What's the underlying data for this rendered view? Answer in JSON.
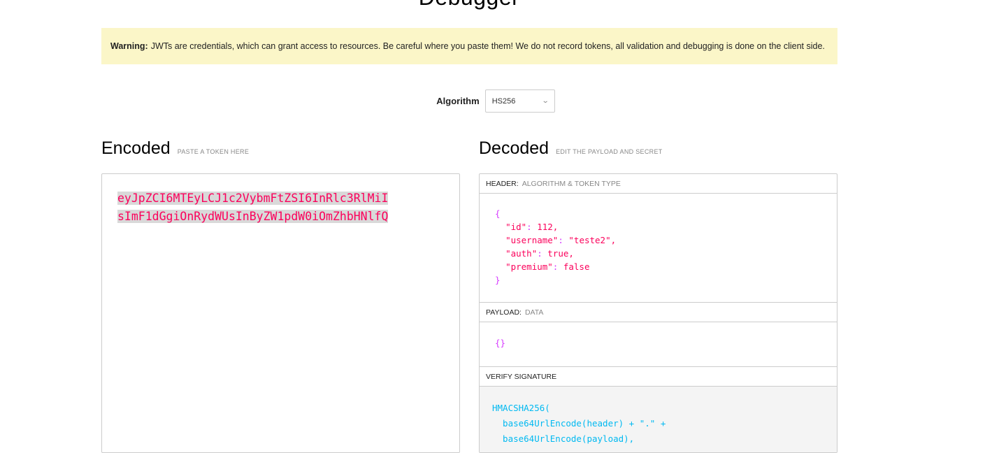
{
  "page": {
    "title": "Debugger"
  },
  "warning": {
    "label": "Warning:",
    "text": "JWTs are credentials, which can grant access to resources. Be careful where you paste them! We do not record tokens, all validation and debugging is done on the client side."
  },
  "algorithm": {
    "label": "Algorithm",
    "selected": "HS256"
  },
  "encoded": {
    "title": "Encoded",
    "hint": "PASTE A TOKEN HERE",
    "token_line1": "eyJpZCI6MTEyLCJ1c2VybmFtZSI6InRlc3RlMiI",
    "token_line2": "sImF1dGgiOnRydWUsInByZW1pdW0iOmZhbHNlfQ"
  },
  "decoded": {
    "title": "Decoded",
    "hint": "EDIT THE PAYLOAD AND SECRET",
    "header_section": {
      "label": "HEADER:",
      "sub": "ALGORITHM & TOKEN TYPE"
    },
    "header_json": {
      "open": "{",
      "lines": [
        {
          "key": "\"id\"",
          "value": "112,"
        },
        {
          "key": "\"username\"",
          "value": "\"teste2\","
        },
        {
          "key": "\"auth\"",
          "value": "true,"
        },
        {
          "key": "\"premium\"",
          "value": "false"
        }
      ],
      "close": "}"
    },
    "payload_section": {
      "label": "PAYLOAD:",
      "sub": "DATA"
    },
    "payload_json": "{}",
    "signature_section": {
      "label": "VERIFY SIGNATURE"
    },
    "signature_lines": [
      "HMACSHA256(",
      "  base64UrlEncode(header) + \".\" +",
      "  base64UrlEncode(payload),"
    ]
  }
}
